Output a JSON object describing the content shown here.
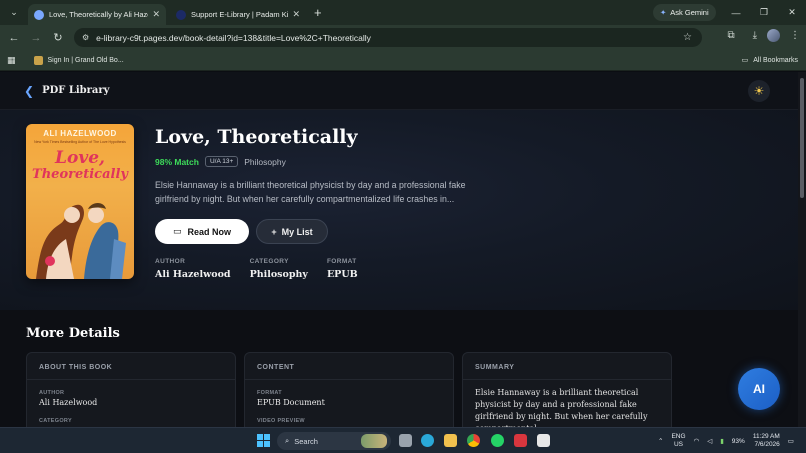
{
  "browser": {
    "tabs": [
      {
        "title": "Love, Theoretically by Ali Hazelwo",
        "active": true
      },
      {
        "title": "Support E-Library | Padam Kishore",
        "active": false
      }
    ],
    "new_tab": "+",
    "ask_gemini": "Ask Gemini",
    "url": "e-library-c9t.pages.dev/book-detail?id=138&title=Love%2C+Theoretically",
    "bookmark_item": "Sign In | Grand Old Bo...",
    "all_bookmarks": "All Bookmarks"
  },
  "header": {
    "brand": "PDF Library",
    "theme_icon": "sun-icon"
  },
  "book": {
    "cover_author": "ALI HAZELWOOD",
    "cover_blurb": "New York Times Bestselling Author of The Love Hypothesis",
    "cover_title_1": "Love,",
    "cover_title_2": "Theoretically",
    "title": "Love, Theoretically",
    "match": "98% Match",
    "rating": "U/A 13+",
    "genre": "Philosophy",
    "description": "Elsie Hannaway is a brilliant theoretical physicist by day and a professional fake girlfriend by night. But when her carefully compartmentalized life crashes in...",
    "read_now": "Read Now",
    "my_list": "My List",
    "facts": [
      {
        "label": "AUTHOR",
        "value": "Ali Hazelwood"
      },
      {
        "label": "CATEGORY",
        "value": "Philosophy"
      },
      {
        "label": "FORMAT",
        "value": "EPUB"
      }
    ]
  },
  "more_details": {
    "heading": "More Details",
    "about": {
      "header": "ABOUT THIS BOOK",
      "author_label": "AUTHOR",
      "author_value": "Ali Hazelwood",
      "category_label": "CATEGORY"
    },
    "content": {
      "header": "CONTENT",
      "format_label": "FORMAT",
      "format_value": "EPUB Document",
      "preview_label": "VIDEO PREVIEW"
    },
    "summary": {
      "header": "SUMMARY",
      "text": "Elsie Hannaway is a brilliant theoretical physicist by day and a professional fake girlfriend by night. But when her carefully compartmental..."
    }
  },
  "ai_button": "AI",
  "taskbar": {
    "search": "Search",
    "lang_1": "ENG",
    "lang_2": "US",
    "battery": "93%",
    "time": "11:29 AM",
    "date": "7/6/2026"
  },
  "colors": {
    "match": "#3ddc5a",
    "ai_button": "#2f7de0",
    "theme_icon": "#f3c94e"
  }
}
